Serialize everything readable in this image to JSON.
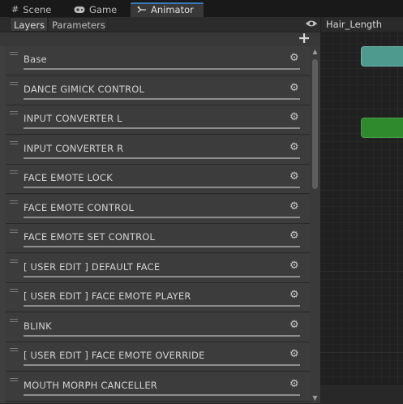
{
  "window_tabs": [
    {
      "label": "Scene",
      "icon": "grid-icon"
    },
    {
      "label": "Game",
      "icon": "gamepad-icon"
    },
    {
      "label": "Animator",
      "icon": "animator-icon",
      "active": true
    }
  ],
  "left_panel": {
    "tabs": [
      {
        "label": "Layers",
        "active": true
      },
      {
        "label": "Parameters",
        "active": false
      }
    ],
    "add_button": "+",
    "layers": [
      {
        "name": "Base"
      },
      {
        "name": "DANCE GIMICK CONTROL"
      },
      {
        "name": "INPUT CONVERTER L"
      },
      {
        "name": "INPUT CONVERTER R"
      },
      {
        "name": "FACE EMOTE LOCK"
      },
      {
        "name": "FACE EMOTE CONTROL"
      },
      {
        "name": "FACE EMOTE SET CONTROL"
      },
      {
        "name": "[ USER EDIT ] DEFAULT FACE"
      },
      {
        "name": "[ USER EDIT ] FACE EMOTE PLAYER"
      },
      {
        "name": "BLINK"
      },
      {
        "name": "[ USER EDIT ] FACE EMOTE OVERRIDE"
      },
      {
        "name": "MOUTH MORPH CANCELLER"
      }
    ]
  },
  "graph": {
    "selected_parameter": "Hair_Length",
    "colors": {
      "node_teal": "#4e9a8e",
      "node_green": "#2f8a2e",
      "accent": "#3a79bb"
    }
  }
}
